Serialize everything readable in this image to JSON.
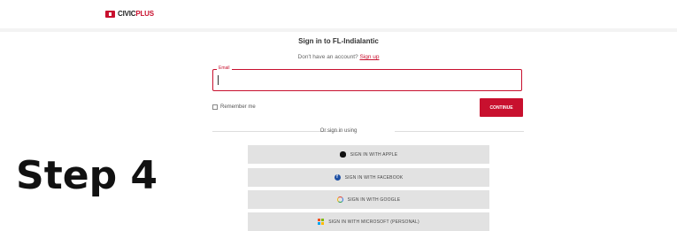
{
  "brand": {
    "prefix": "CIVIC",
    "suffix": "PLUS",
    "color": "#c8102e"
  },
  "signin": {
    "title": "Sign in to FL-Indialantic",
    "no_account_text": "Don't have an account?",
    "signup_link": "Sign up"
  },
  "email": {
    "label": "Email",
    "value": ""
  },
  "remember": {
    "label": "Remember me",
    "checked": false
  },
  "continue_label": "CONTINUE",
  "divider_text": "Or sign in using",
  "sso": {
    "apple": "SIGN IN WITH APPLE",
    "facebook": "SIGN IN WITH FACEBOOK",
    "google": "SIGN IN WITH GOOGLE",
    "microsoft": "SIGN IN WITH MICROSOFT (PERSONAL)"
  },
  "step_label": "Step 4",
  "colors": {
    "accent": "#c8102e",
    "button_gray": "#e2e2e2",
    "facebook_blue": "#1d4fa3",
    "microsoft": [
      "#f25022",
      "#7fba00",
      "#00a4ef",
      "#ffb900"
    ]
  }
}
